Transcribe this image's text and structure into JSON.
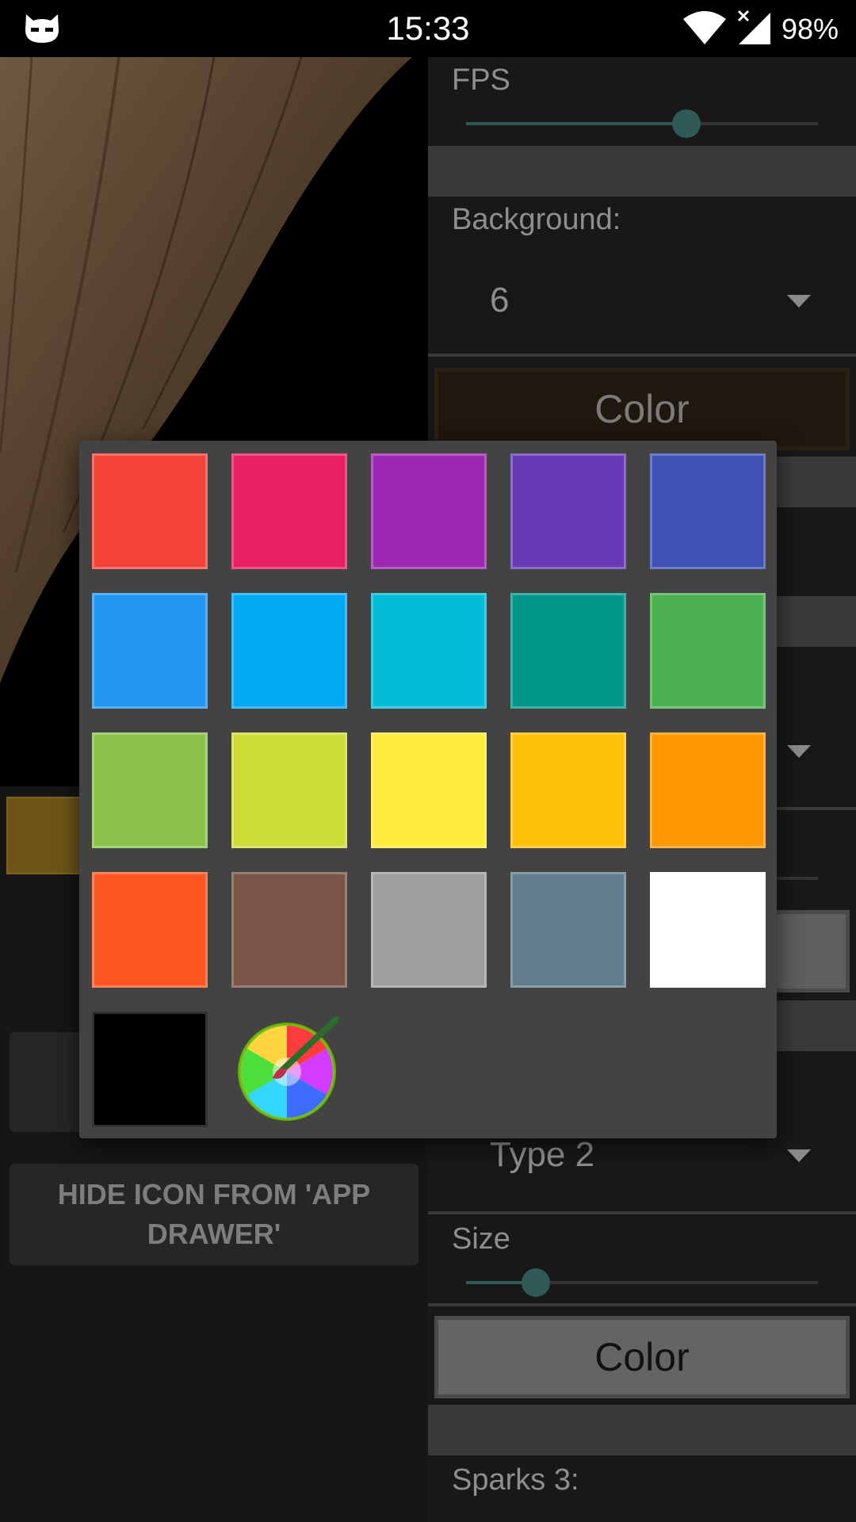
{
  "status_bar": {
    "time": "15:33",
    "battery": "98%",
    "left_icon": "cyanogen-cat-icon",
    "icons": [
      "wifi-icon",
      "signal-no-data-icon"
    ]
  },
  "left_panel": {
    "hide_icon_button": "HIDE ICON FROM 'APP DRAWER'",
    "swatch_color": "#6e5418"
  },
  "settings": {
    "fps_label": "FPS",
    "fps_slider_fraction": 0.63,
    "background_label": "Background:",
    "background_value": "6",
    "color_button": "Color",
    "type_value": "Type 2",
    "size_label": "Size",
    "size_slider_fraction": 0.2,
    "color_button_2": "Color",
    "sparks_label": "Sparks 3:"
  },
  "color_picker": {
    "colors": [
      "#F44336",
      "#E91E63",
      "#9C27B0",
      "#673AB7",
      "#3F51B5",
      "#2196F3",
      "#03A9F4",
      "#00BCD4",
      "#009688",
      "#4CAF50",
      "#8BC34A",
      "#CDDC39",
      "#FFEB3B",
      "#FFC107",
      "#FF9800",
      "#FF5722",
      "#795548",
      "#9E9E9E",
      "#607D8B",
      "#FFFFFF",
      "#000000"
    ],
    "custom_icon": "color-wheel-brush-icon"
  }
}
